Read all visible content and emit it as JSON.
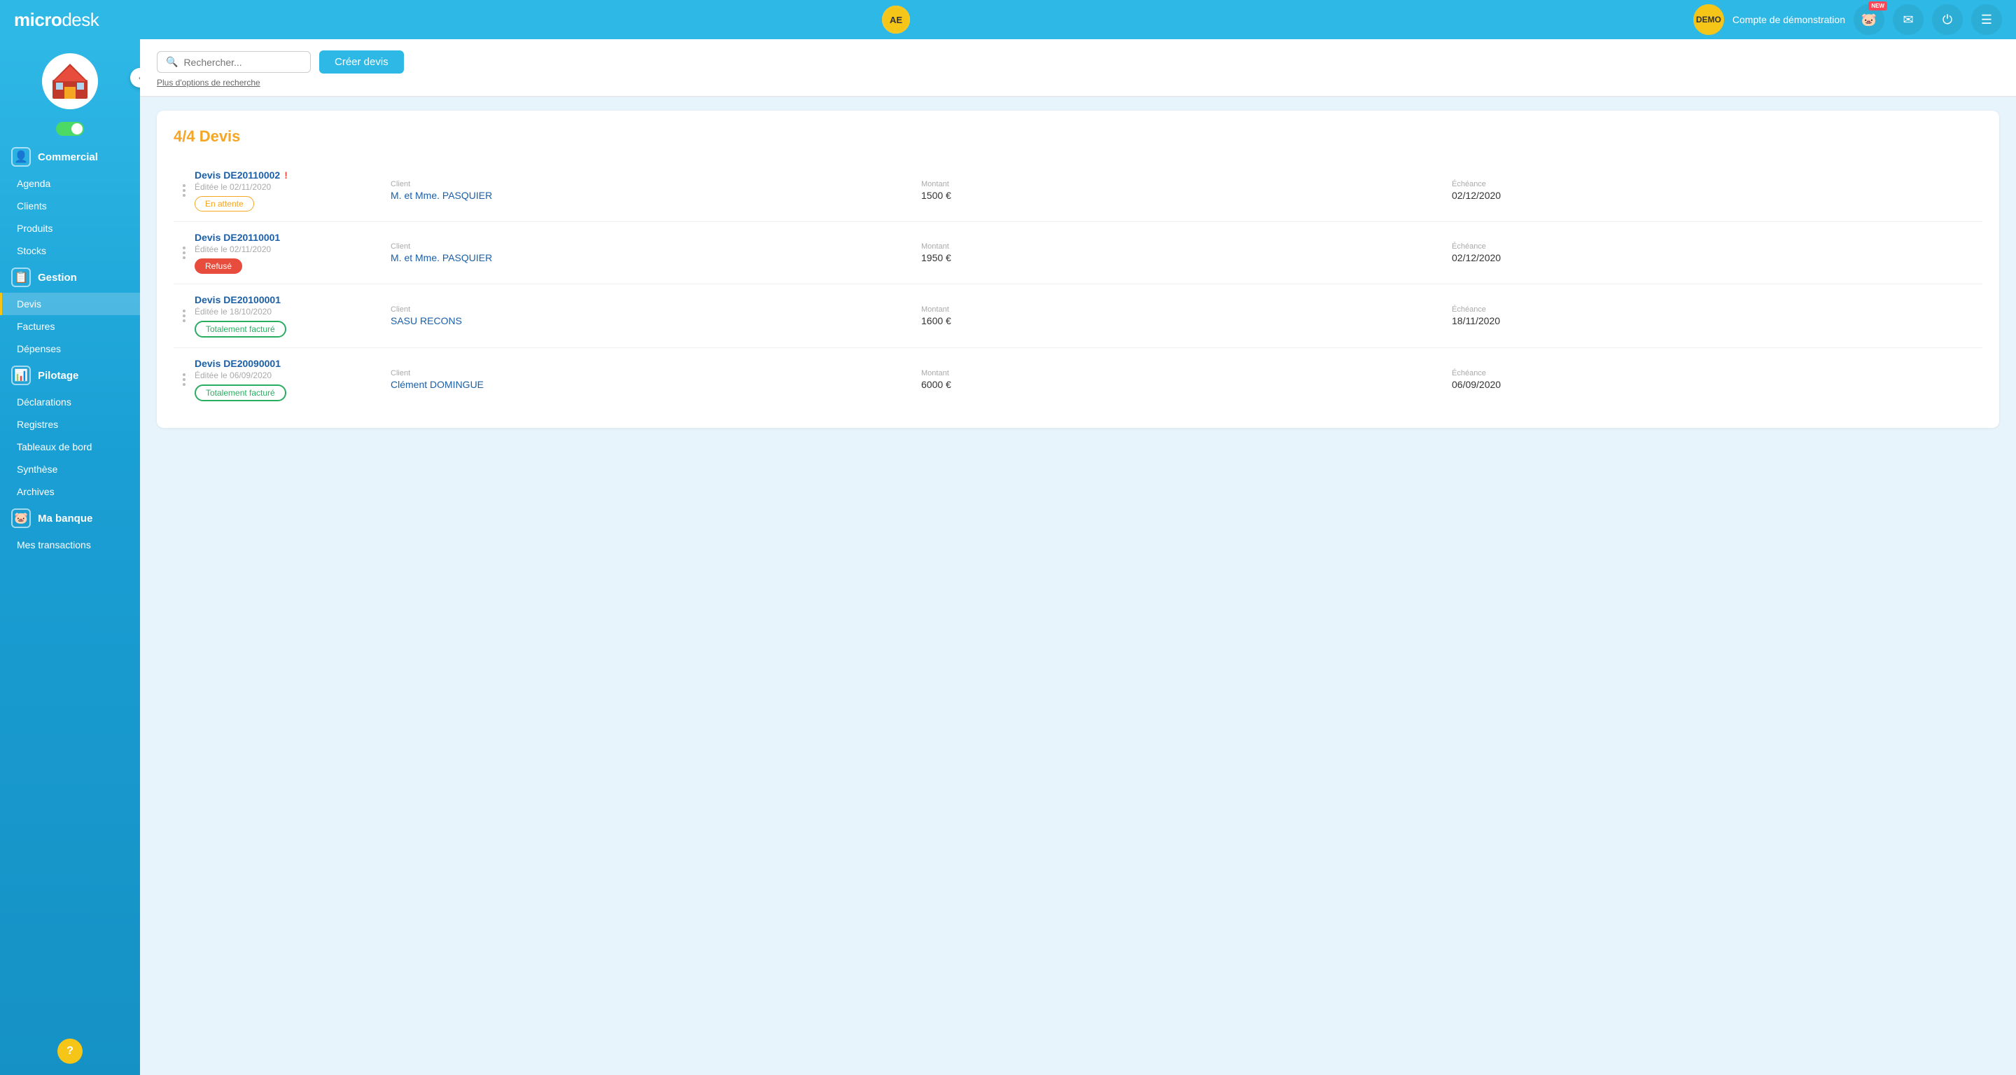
{
  "header": {
    "logo_micro": "micro",
    "logo_desk": "desk",
    "ae_label": "AE",
    "account_label": "Compte de démonstration",
    "demo_label": "DEMO",
    "new_badge": "NEW",
    "piggy_btn_label": "piggy-bank",
    "mail_btn_label": "mail",
    "power_btn_label": "power",
    "settings_btn_label": "settings"
  },
  "sidebar": {
    "toggle_state": "on",
    "section_commercial": "Commercial",
    "items_commercial": [
      "Agenda",
      "Clients",
      "Produits",
      "Stocks"
    ],
    "section_gestion": "Gestion",
    "items_gestion": [
      "Devis",
      "Factures",
      "Dépenses"
    ],
    "section_pilotage": "Pilotage",
    "items_pilotage": [
      "Déclarations",
      "Registres",
      "Tableaux de bord",
      "Synthèse",
      "Archives"
    ],
    "section_banque": "Ma banque",
    "items_banque": [
      "Mes transactions"
    ],
    "active_item": "Devis",
    "help_label": "?"
  },
  "search": {
    "placeholder": "Rechercher...",
    "create_button": "Créer devis",
    "more_search_link": "Plus d'options de recherche"
  },
  "content": {
    "count_title": "4/4 Devis",
    "devis": [
      {
        "id": "Devis DE20110002",
        "alert": "!",
        "edit_date": "Éditée le 02/11/2020",
        "status": "En attente",
        "status_type": "pending",
        "client_label": "Client",
        "client": "M. et Mme. PASQUIER",
        "montant_label": "Montant",
        "montant": "1500 €",
        "echeance_label": "Échéance",
        "echeance": "02/12/2020"
      },
      {
        "id": "Devis DE20110001",
        "alert": "",
        "edit_date": "Éditée le 02/11/2020",
        "status": "Refusé",
        "status_type": "refused",
        "client_label": "Client",
        "client": "M. et Mme. PASQUIER",
        "montant_label": "Montant",
        "montant": "1950 €",
        "echeance_label": "Échéance",
        "echeance": "02/12/2020"
      },
      {
        "id": "Devis DE20100001",
        "alert": "",
        "edit_date": "Éditée le 18/10/2020",
        "status": "Totalement facturé",
        "status_type": "billed",
        "client_label": "Client",
        "client": "SASU RECONS",
        "montant_label": "Montant",
        "montant": "1600 €",
        "echeance_label": "Échéance",
        "echeance": "18/11/2020"
      },
      {
        "id": "Devis DE20090001",
        "alert": "",
        "edit_date": "Éditée le 06/09/2020",
        "status": "Totalement facturé",
        "status_type": "billed",
        "client_label": "Client",
        "client": "Clément DOMINGUE",
        "montant_label": "Montant",
        "montant": "6000 €",
        "echeance_label": "Échéance",
        "echeance": "06/09/2020"
      }
    ]
  }
}
